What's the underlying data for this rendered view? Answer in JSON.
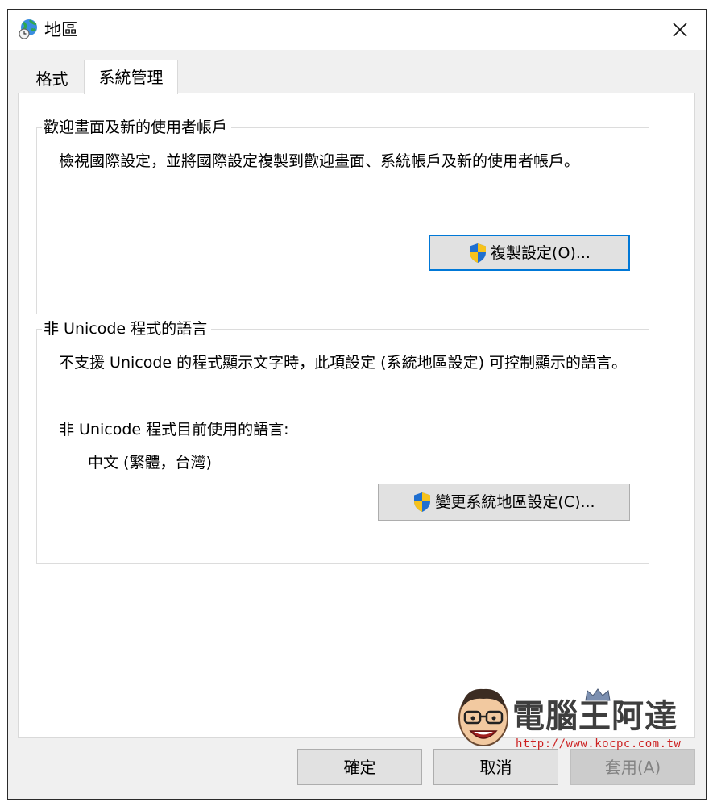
{
  "window": {
    "title": "地區",
    "title_icon": "globe-clock-icon",
    "close_icon": "close-icon"
  },
  "tabs": [
    {
      "label": "格式",
      "active": false
    },
    {
      "label": "系統管理",
      "active": true
    }
  ],
  "welcome_group": {
    "legend": "歡迎畫面及新的使用者帳戶",
    "description": "檢視國際設定，並將國際設定複製到歡迎畫面、系統帳戶及新的使用者帳戶。",
    "copy_button_label": "複製設定(O)...",
    "button_icon": "uac-shield-icon"
  },
  "nonunicode_group": {
    "legend": "非 Unicode 程式的語言",
    "description": "不支援 Unicode 的程式顯示文字時，此項設定 (系統地區設定) 可控制顯示的語言。",
    "current_label": "非 Unicode 程式目前使用的語言:",
    "current_value": "中文 (繁體，台灣)",
    "change_button_label": "變更系統地區設定(C)...",
    "button_icon": "uac-shield-icon"
  },
  "footer": {
    "ok_label": "確定",
    "cancel_label": "取消",
    "apply_label": "套用(A)",
    "apply_enabled": false
  },
  "watermark": {
    "title": "電腦王阿達",
    "url": "http://www.kocpc.com.tw"
  },
  "colors": {
    "default_button_border": "#0078d7",
    "shield_blue": "#1f6fd0",
    "shield_yellow": "#f6c21c",
    "watermark_url": "#cc2020"
  }
}
